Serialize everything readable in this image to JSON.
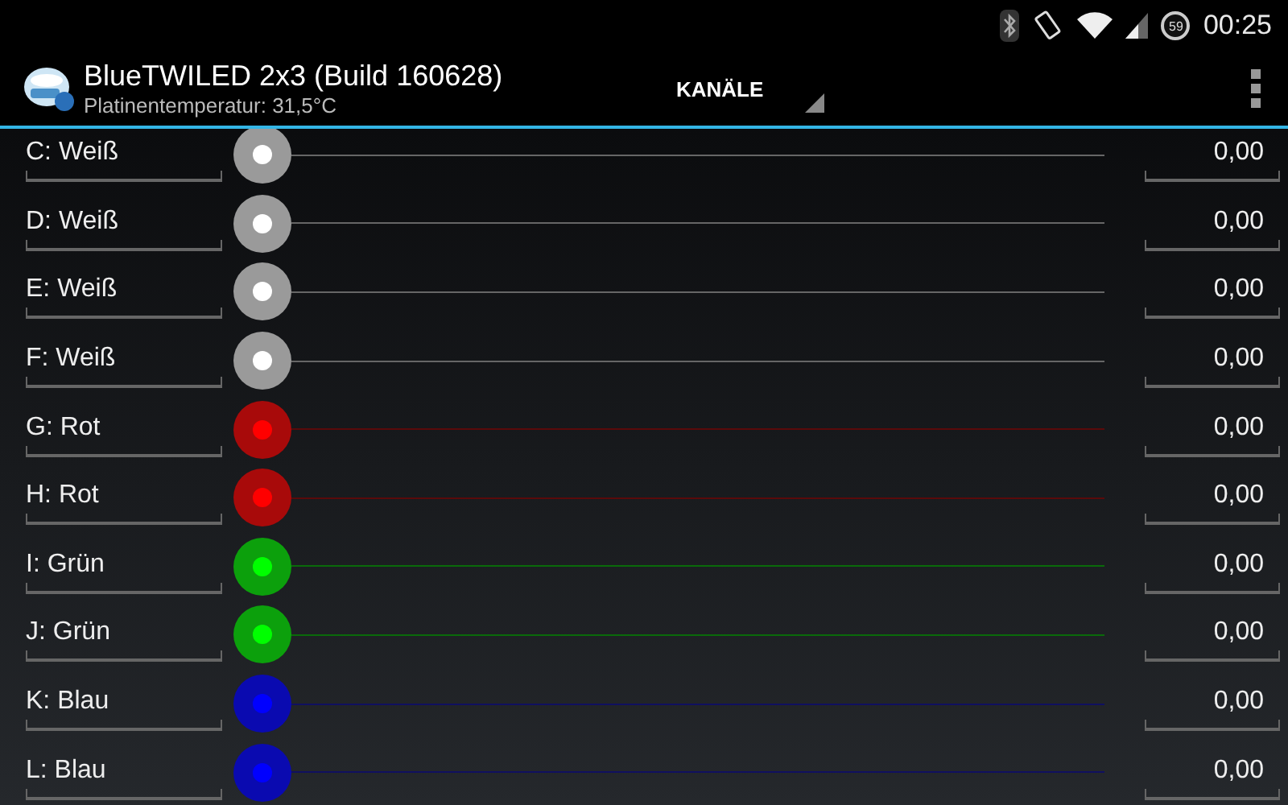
{
  "status_bar": {
    "battery_percent": "59",
    "time": "00:25"
  },
  "action_bar": {
    "title": "BlueTWILED 2x3 (Build 160628)",
    "subtitle": "Platinentemperatur: 31,5°C",
    "spinner": "KANÄLE"
  },
  "channels": [
    {
      "name": "C: Weiß",
      "color": "#ffffff",
      "value": "0,00"
    },
    {
      "name": "D: Weiß",
      "color": "#ffffff",
      "value": "0,00"
    },
    {
      "name": "E: Weiß",
      "color": "#ffffff",
      "value": "0,00"
    },
    {
      "name": "F: Weiß",
      "color": "#ffffff",
      "value": "0,00"
    },
    {
      "name": "G: Rot",
      "color": "#ff0000",
      "value": "0,00"
    },
    {
      "name": "H: Rot",
      "color": "#ff0000",
      "value": "0,00"
    },
    {
      "name": "I: Grün",
      "color": "#00ff00",
      "value": "0,00"
    },
    {
      "name": "J: Grün",
      "color": "#00ff00",
      "value": "0,00"
    },
    {
      "name": "K: Blau",
      "color": "#0000ff",
      "value": "0,00"
    },
    {
      "name": "L: Blau",
      "color": "#0000ff",
      "value": "0,00"
    }
  ]
}
